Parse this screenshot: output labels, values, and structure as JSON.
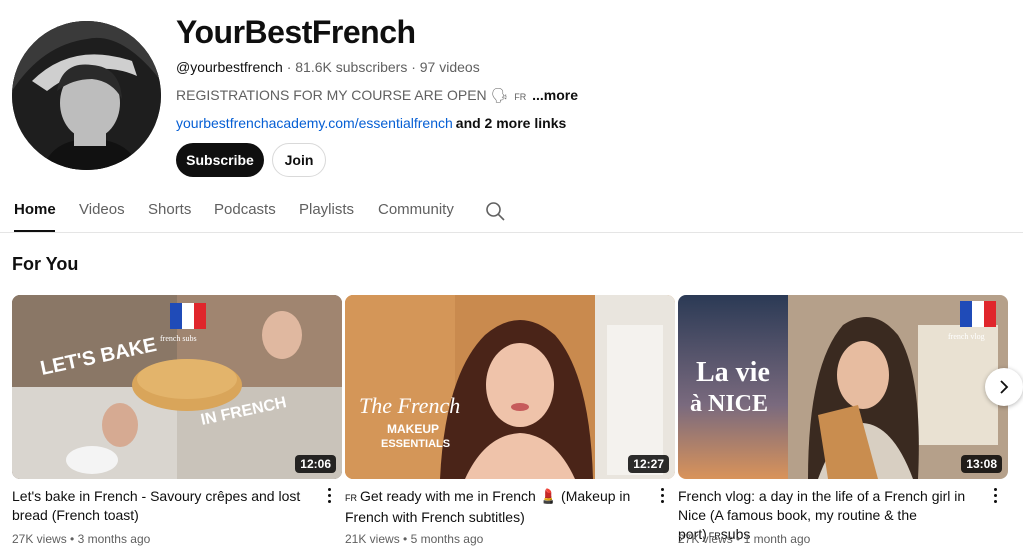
{
  "channel": {
    "name": "YourBestFrench",
    "handle": "@yourbestfrench",
    "stats": " · 81.6K subscribers · 97 videos",
    "description": "REGISTRATIONS FOR MY COURSE ARE OPEN 🗣",
    "description_flag": "FR",
    "description_more": "...more",
    "link": "yourbestfrenchacademy.com/essentialfrench",
    "more_links": "and 2 more links",
    "subscribe_label": "Subscribe",
    "join_label": "Join"
  },
  "tabs": [
    "Home",
    "Videos",
    "Shorts",
    "Podcasts",
    "Playlists",
    "Community"
  ],
  "section_title": "For You",
  "videos": [
    {
      "title": "Let's bake in French - Savoury crêpes and lost bread (French toast)",
      "views": "27K views",
      "age": "3 months ago",
      "duration": "12:06",
      "thumb_text_1": "LET'S BAKE",
      "thumb_text_2": "IN FRENCH",
      "thumb_tag": "french subs"
    },
    {
      "title_badge": "FR",
      "title": "Get ready with me in French 💄 (Makeup in French with French subtitles)",
      "views": "21K views",
      "age": "5 months ago",
      "duration": "12:27",
      "thumb_text_1": "The French",
      "thumb_text_2": "MAKEUP",
      "thumb_text_3": "ESSENTIALS"
    },
    {
      "title": "French vlog: a day in the life of a French girl in Nice (A famous book, my routine & the port)",
      "title_suffix_badge": "FR",
      "title_suffix": "subs",
      "views": "27K views",
      "age": "1 month ago",
      "duration": "13:08",
      "thumb_text_1": "La vie",
      "thumb_text_2": "à NICE",
      "thumb_tag": "french vlog"
    }
  ],
  "colors": {
    "link": "#065fd4",
    "text_secondary": "#606060",
    "subscribe_bg": "#0f0f0f"
  },
  "icons": [
    "search-icon",
    "chevron-right-icon",
    "more-vert-icon"
  ]
}
